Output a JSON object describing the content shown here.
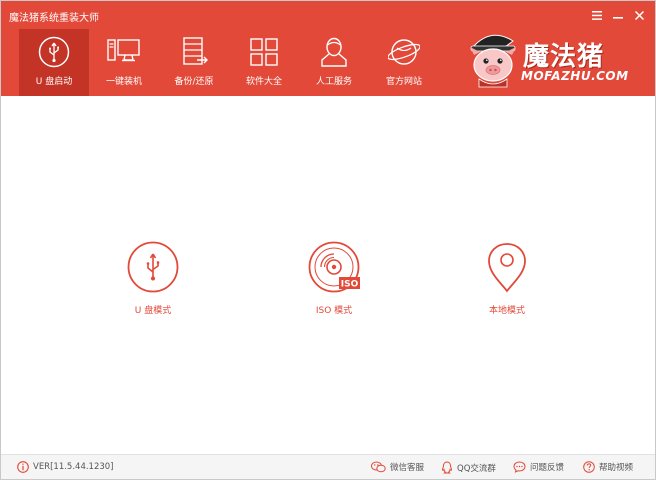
{
  "window": {
    "title": "魔法猪系统重装大师"
  },
  "brand": {
    "name_cn": "魔法猪",
    "name_en": "MOFAZHU.COM",
    "accent": "#e24939",
    "accent_dark": "#c33326"
  },
  "nav": {
    "items": [
      {
        "label": "U 盘启动",
        "icon": "usb-icon"
      },
      {
        "label": "一键装机",
        "icon": "computer-icon"
      },
      {
        "label": "备份/还原",
        "icon": "backup-document-icon"
      },
      {
        "label": "软件大全",
        "icon": "apps-grid-icon"
      },
      {
        "label": "人工服务",
        "icon": "person-icon"
      },
      {
        "label": "官方网站",
        "icon": "globe-icon"
      }
    ],
    "active_index": 0
  },
  "modes": [
    {
      "label": "U 盘模式",
      "icon": "usb-circle-icon"
    },
    {
      "label": "ISO 模式",
      "icon": "iso-disc-icon"
    },
    {
      "label": "本地模式",
      "icon": "location-pin-icon"
    }
  ],
  "footer": {
    "version": "VER[11.5.44.1230]",
    "links": [
      {
        "label": "微信客服",
        "icon": "wechat-icon"
      },
      {
        "label": "QQ交流群",
        "icon": "qq-icon"
      },
      {
        "label": "问题反馈",
        "icon": "chat-bubble-icon"
      },
      {
        "label": "帮助视频",
        "icon": "help-icon"
      }
    ]
  },
  "iso_badge": "ISO"
}
